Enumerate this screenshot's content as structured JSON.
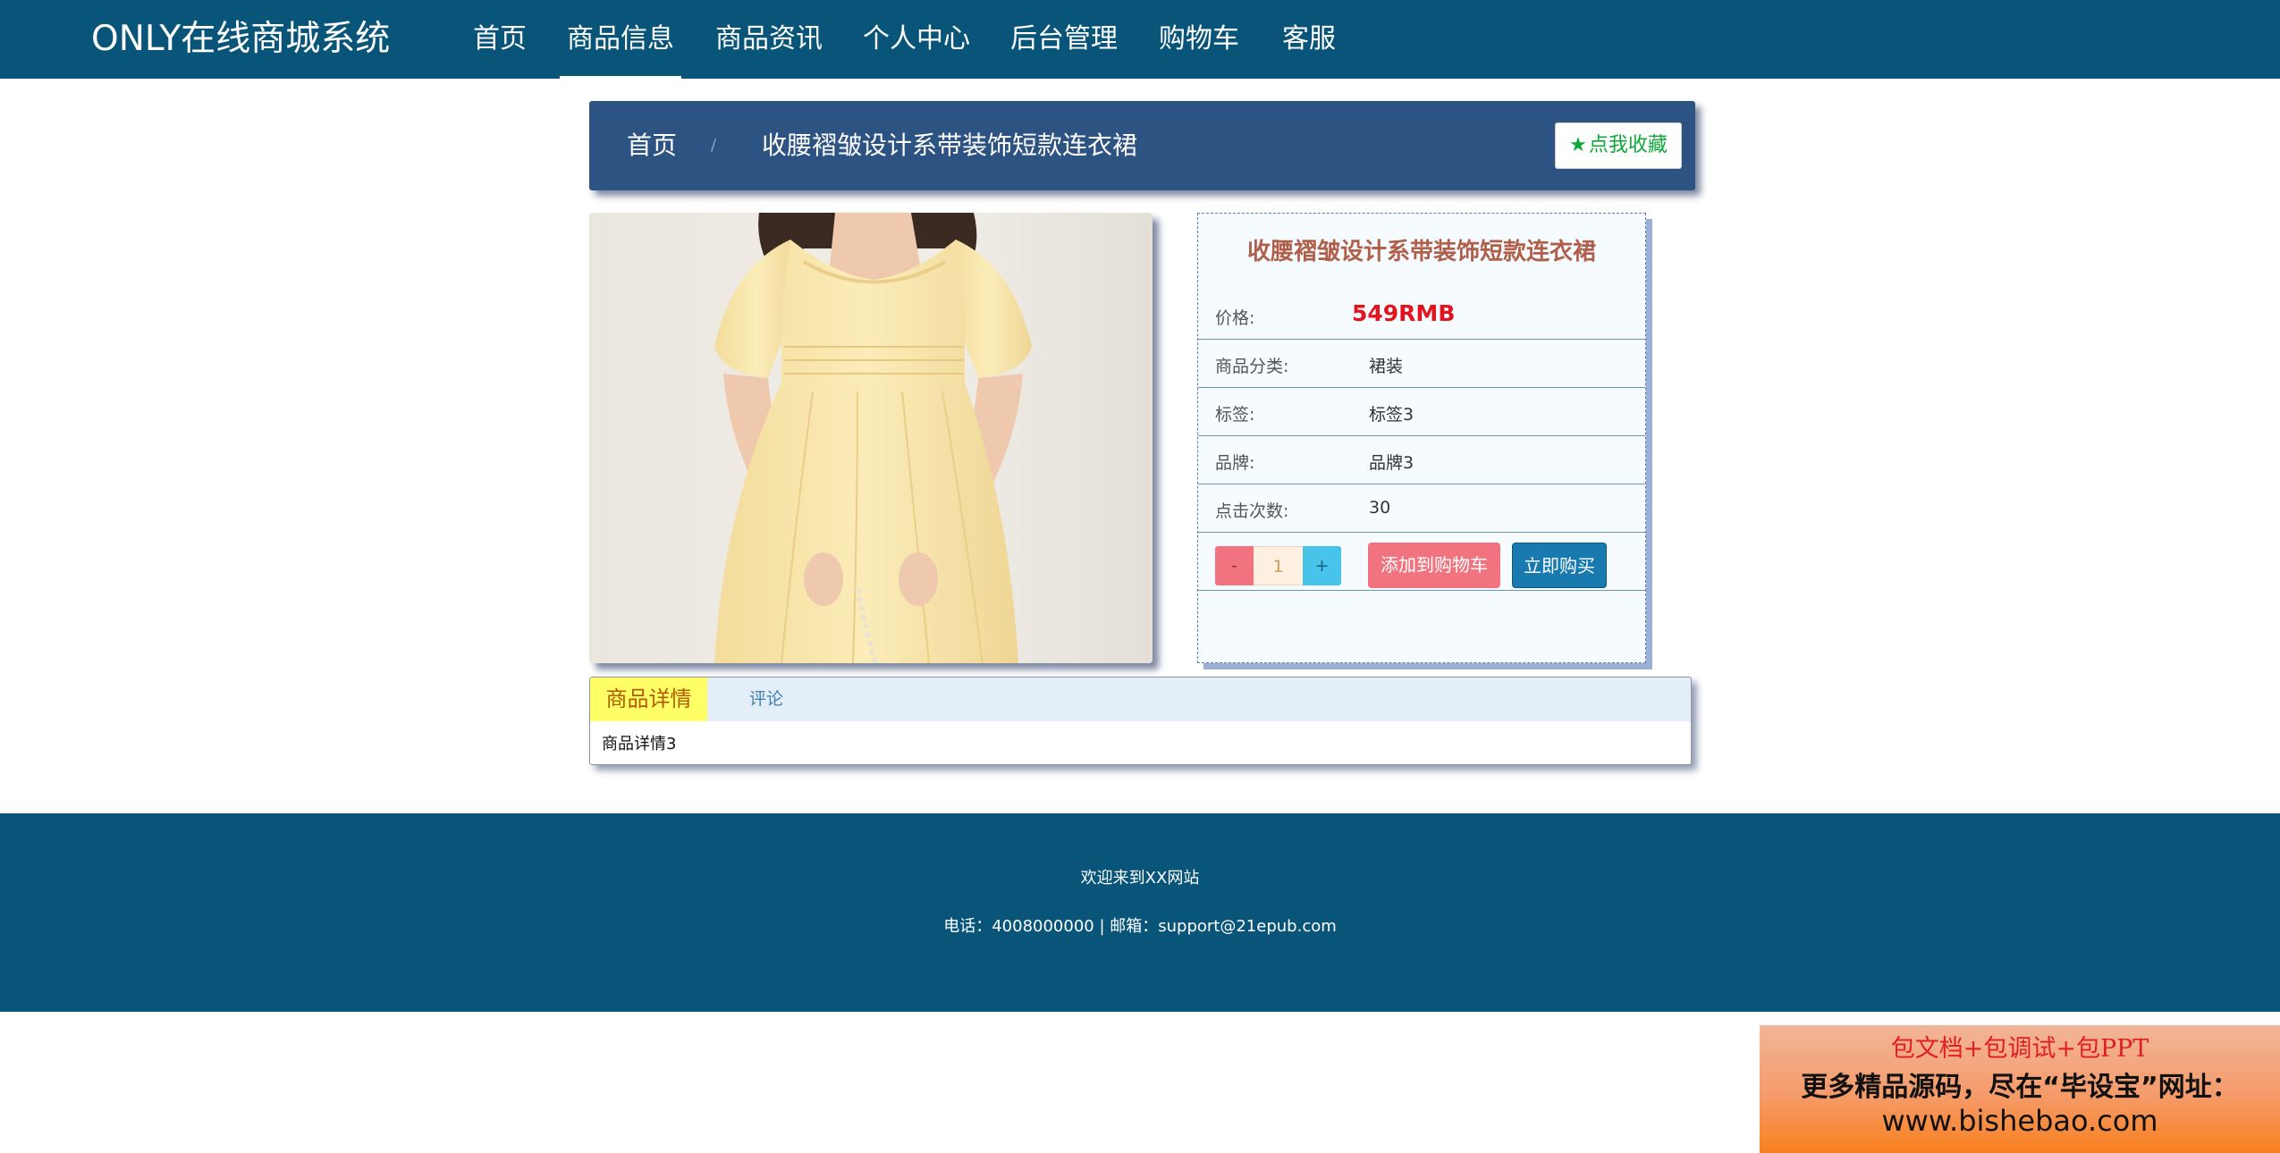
{
  "nav": {
    "brand": "ONLY在线商城系统",
    "items": [
      {
        "label": "首页"
      },
      {
        "label": "商品信息"
      },
      {
        "label": "商品资讯"
      },
      {
        "label": "个人中心"
      },
      {
        "label": "后台管理"
      },
      {
        "label": "购物车"
      },
      {
        "label": "客服"
      }
    ],
    "active_item": "商品信息"
  },
  "breadcrumb": {
    "home": "首页",
    "separator": "/",
    "current": "收腰褶皱设计系带装饰短款连衣裙",
    "favorite_label": "点我收藏",
    "favorite_icon": "star-icon"
  },
  "product": {
    "image_alt": "yellow-dress-photo",
    "title": "收腰褶皱设计系带装饰短款连衣裙",
    "price_label": "价格:",
    "price": "549RMB",
    "category_label": "商品分类:",
    "category": "裙装",
    "tag_label": "标签:",
    "tag": "标签3",
    "brand_label": "品牌:",
    "brand": "品牌3",
    "clicks_label": "点击次数:",
    "clicks": "30",
    "quantity_minus": "-",
    "quantity": "1",
    "quantity_plus": "+",
    "add_to_cart": "添加到购物车",
    "buy_now": "立即购买"
  },
  "detail": {
    "tabs": [
      {
        "label": "商品详情"
      },
      {
        "label": "评论"
      }
    ],
    "active_tab": "商品详情",
    "content": "商品详情3"
  },
  "footer": {
    "welcome": "欢迎来到XX网站",
    "contact": "电话：4008000000 | 邮箱：support@21epub.com"
  },
  "promo": {
    "line1": "包文档+包调试+包PPT",
    "line2": "更多精品源码，尽在“毕设宝”网址：",
    "line3": "www.bishebao.com"
  },
  "colors": {
    "nav_bg": "#085579",
    "breadcrumb_bg": "#2d5383",
    "price": "#e2131c",
    "title": "#b0604a",
    "add_cart": "#f0737f",
    "buy_now": "#187aae",
    "active_tab": "#ffff66"
  }
}
